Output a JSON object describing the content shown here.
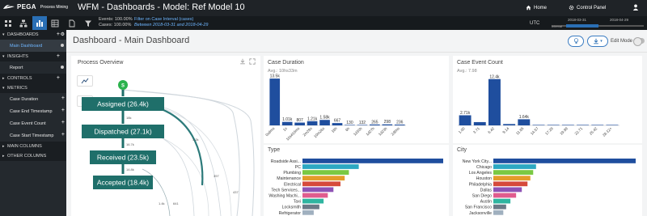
{
  "app": {
    "brand": "PEGA",
    "brand_sub": "Process Mining",
    "title": "WFM - Dashboards - Model: Ref Model 10"
  },
  "nav": {
    "home": "Home",
    "control_panel": "Control Panel"
  },
  "filter_bar": {
    "events": "Events: 100.00%",
    "cases": "Cases: 100.00%",
    "filter_label": "Filter on Case Interval (cases)",
    "filter_range": "Between 2018-03-31 and 2018-04-29",
    "timezone": "UTC",
    "timeline_from": "2018-03-31",
    "timeline_to": "2018-04-29",
    "timeline_label": "Interval"
  },
  "sidebar": {
    "sections": [
      {
        "label": "DASHBOARDS",
        "items": [
          {
            "label": "Main Dashboard",
            "active": true
          }
        ]
      },
      {
        "label": "INSIGHTS",
        "items": [
          {
            "label": "Report"
          }
        ]
      },
      {
        "label": "CONTROLS",
        "items": []
      },
      {
        "label": "METRICS",
        "items": [
          {
            "label": "Case Duration"
          },
          {
            "label": "Case End Timestamp"
          },
          {
            "label": "Case Event Count"
          },
          {
            "label": "Case Start Timestamp"
          }
        ]
      },
      {
        "label": "MAIN COLUMNS",
        "items": []
      },
      {
        "label": "OTHER COLUMNS",
        "items": []
      }
    ]
  },
  "dashboard": {
    "title": "Dashboard - Main Dashboard",
    "edit_mode": "Edit Mode"
  },
  "process_overview": {
    "title": "Process Overview",
    "start_label": "S",
    "nodes": [
      "Assigned  (26.4k)",
      "Dispatched  (27.1k)",
      "Received  (23.5k)",
      "Accepted  (18.4k)"
    ],
    "edge_labels": [
      "18k",
      "16.7k",
      "397",
      "437",
      "3.2k",
      "14.8k",
      "641",
      "1.4k"
    ]
  },
  "chart_data": [
    {
      "type": "bar",
      "title": "Case Duration",
      "subtitle": "Avg.: 10hs33m",
      "categories": [
        "0s8ms",
        "1s",
        "10s416ms",
        "2m29s",
        "10m26s",
        "18h",
        "6h",
        "1d10h",
        "1d27h",
        "1d23h",
        "2d6hs"
      ],
      "values": [
        13.5,
        1.01,
        0.807,
        1.21,
        1.58,
        0.667,
        0.13,
        0.132,
        0.265,
        0.298,
        0.236
      ],
      "value_labels": [
        "13.5k",
        "1.01k",
        "807",
        "1.21k",
        "1.58k",
        "667",
        "130",
        "132",
        "265",
        "298",
        "236"
      ],
      "ylim": [
        0,
        14
      ]
    },
    {
      "type": "bar",
      "title": "Case Event Count",
      "subtitle": "Avg.: 7.98",
      "categories": [
        "1.00",
        "3.71",
        "6.42",
        "9.14",
        "11.85",
        "14.57",
        "17.28",
        "19.99",
        "22.71",
        "25.42",
        "28.12+"
      ],
      "values": [
        2.71,
        0.88,
        12.4,
        0.36,
        1.64,
        0.01,
        0.01,
        0.01,
        0.01,
        0.01,
        0.001
      ],
      "value_labels": [
        "2.71k",
        "",
        "12.4k",
        "",
        "1.64k",
        "",
        "",
        "",
        "",
        "",
        ""
      ],
      "ylim": [
        0,
        13
      ]
    },
    {
      "type": "bar",
      "title": "Type",
      "categories": [
        "Roadside Assi...",
        "PC",
        "Plumbing",
        "Maintenance",
        "Electrical",
        "Tech Services...",
        "Washing Machi...",
        "Taxi",
        "Locksmith",
        "Refrigerator"
      ],
      "values": [
        100,
        40,
        33,
        30,
        27,
        22,
        18,
        15,
        12,
        8
      ],
      "colors": [
        "#1f4e9e",
        "#2ca8c2",
        "#7ac943",
        "#e39c2b",
        "#d64a3b",
        "#8e52b5",
        "#e05c8e",
        "#2fb5a0",
        "#6b7a87",
        "#a0b0bf"
      ]
    },
    {
      "type": "bar",
      "title": "City",
      "categories": [
        "New York City...",
        "Chicago",
        "Los Angeles",
        "Houston",
        "Philadelphia",
        "Dallas",
        "San Diego",
        "Austin",
        "San Francisco",
        "Jacksonville"
      ],
      "values": [
        100,
        30,
        28,
        26,
        24,
        20,
        16,
        12,
        9,
        7
      ],
      "colors": [
        "#1f4e9e",
        "#2ca8c2",
        "#7ac943",
        "#e39c2b",
        "#d64a3b",
        "#8e52b5",
        "#e05c8e",
        "#2fb5a0",
        "#6b7a87",
        "#a0b0bf"
      ]
    }
  ]
}
